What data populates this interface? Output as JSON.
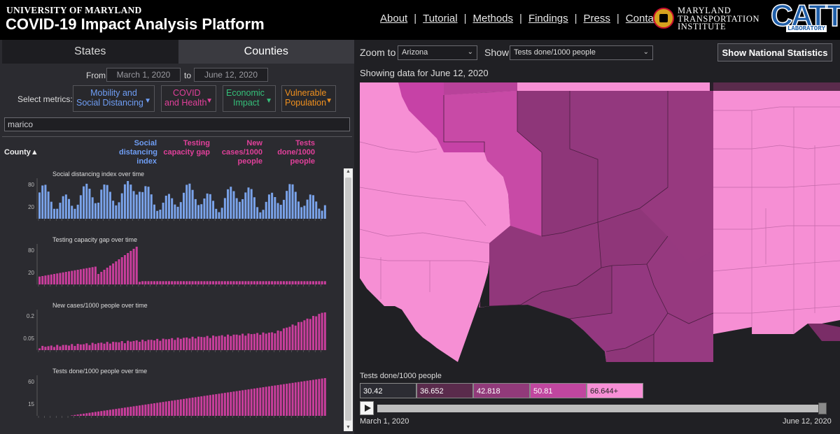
{
  "header": {
    "university": "UNIVERSITY OF MARYLAND",
    "title": "COVID-19 Impact Analysis Platform",
    "nav": [
      "About",
      "Tutorial",
      "Methods",
      "Findings",
      "Press",
      "Contact"
    ],
    "mti_line1": "MARYLAND",
    "mti_line2": "TRANSPORTATION",
    "mti_line3": "INSTITUTE",
    "catt_big": "CATT",
    "catt_small": "LABORATORY"
  },
  "left": {
    "tabs": [
      "States",
      "Counties"
    ],
    "active_tab": "Counties",
    "from_label": "From",
    "to_label": "to",
    "from_date": "March 1, 2020",
    "to_date": "June 12, 2020",
    "metrics_label": "Select metrics:",
    "metrics": [
      {
        "line1": "Mobility and",
        "line2": "Social Distancing",
        "color": "#6f9ef5"
      },
      {
        "line1": "COVID",
        "line2": "and Health",
        "color": "#e0409a"
      },
      {
        "line1": "Economic",
        "line2": "Impact",
        "color": "#35c07a"
      },
      {
        "line1": "Vulnerable",
        "line2": "Population",
        "color": "#f0901e"
      }
    ],
    "search_value": "marico",
    "county_header": "County",
    "sort_icon": "triangle-up-icon",
    "columns": [
      {
        "l1": "Social",
        "l2": "distancing",
        "l3": "index",
        "color": "#6f9ef5"
      },
      {
        "l1": "Testing",
        "l2": "capacity gap",
        "l3": "",
        "color": "#e0409a"
      },
      {
        "l1": "New",
        "l2": "cases/1000",
        "l3": "people",
        "color": "#e0409a"
      },
      {
        "l1": "Tests",
        "l2": "done/1000",
        "l3": "people",
        "color": "#e0409a"
      }
    ],
    "charts": [
      {
        "title": "Social distancing index over time",
        "yticks": [
          "80",
          "20"
        ],
        "color": "#7aa3ea"
      },
      {
        "title": "Testing capacity gap over time",
        "yticks": [
          "80",
          "20"
        ],
        "color": "#c93e9c"
      },
      {
        "title": "New cases/1000 people over time",
        "yticks": [
          "0.2",
          "0.05"
        ],
        "color": "#c93e9c"
      },
      {
        "title": "Tests done/1000 people over time",
        "yticks": [
          "60",
          "15"
        ],
        "color": "#c93e9c"
      }
    ]
  },
  "right": {
    "zoom_label": "Zoom to",
    "zoom_value": "Arizona",
    "show_label": "Show",
    "show_value": "Tests done/1000 people",
    "national_button": "Show National Statistics",
    "showing_text": "Showing data for June 12, 2020",
    "legend_title": "Tests done/1000 people",
    "legend": [
      {
        "label": "30.42",
        "color": "#2c2c33"
      },
      {
        "label": "36.652",
        "color": "#5a2b4c"
      },
      {
        "label": "42.818",
        "color": "#913a7a"
      },
      {
        "label": "50.81",
        "color": "#c0469f"
      },
      {
        "label": "66.644+",
        "color": "#f78fd6"
      }
    ],
    "date_start": "March 1, 2020",
    "date_end": "June 12, 2020",
    "play_icon": "play-icon"
  }
}
